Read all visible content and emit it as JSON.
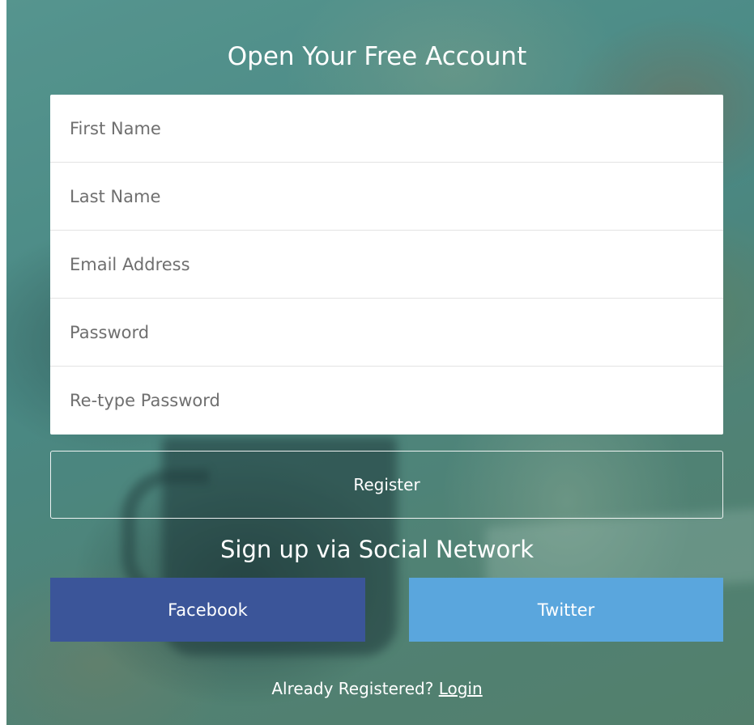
{
  "form": {
    "title": "Open Your Free Account",
    "fields": [
      {
        "placeholder": "First Name",
        "value": ""
      },
      {
        "placeholder": "Last Name",
        "value": ""
      },
      {
        "placeholder": "Email Address",
        "value": ""
      },
      {
        "placeholder": "Password",
        "value": ""
      },
      {
        "placeholder": "Re-type Password",
        "value": ""
      }
    ],
    "register_label": "Register"
  },
  "social": {
    "heading": "Sign up via Social Network",
    "facebook_label": "Facebook",
    "twitter_label": "Twitter"
  },
  "footer": {
    "prompt": "Already Registered?",
    "login_label": "Login"
  },
  "colors": {
    "facebook": "#3b5599",
    "twitter": "#5aa6dd",
    "text_light": "#ffffff"
  }
}
